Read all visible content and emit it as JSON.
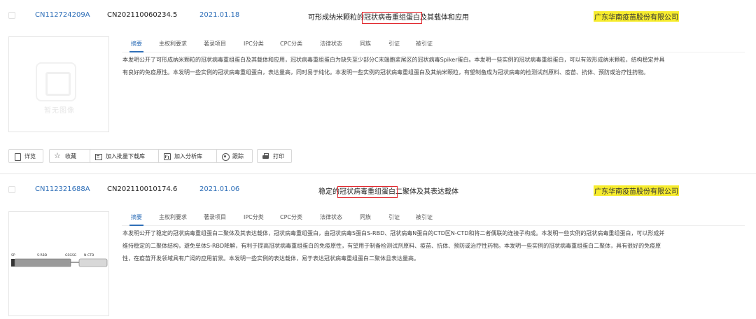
{
  "results": [
    {
      "publication_no": "CN112724209A",
      "application_no": "CN202110060234.5",
      "date": "2021.01.18",
      "title_pre": "可形成纳米颗粒的",
      "title_hl": "冠状病毒重组蛋白",
      "title_post": "及其载体和应用",
      "owner": "广东华南疫苗股份有限公司",
      "thumbnail_placeholder": "暂无图像",
      "tabs": [
        "摘要",
        "主权利要求",
        "著录项目",
        "IPC分类",
        "CPC分类",
        "法律状态",
        "同族",
        "引证",
        "被引证"
      ],
      "active_tab": "摘要",
      "abstract_lines": [
        "本发明公开了可形成纳米颗粒的冠状病毒重组蛋白及其载体和应用，冠状病毒重组蛋白为缺失至少部分C末端胞浆尾区的冠状病毒Spiker蛋白。本发明一些实例的冠状病毒重组蛋白，可以有效形成纳米颗粒，结构稳定并具",
        "有良好的免疫原性。本发明一些实例的冠状病毒重组蛋白，表达量高，同时易于纯化。本发明一些实例的冠状病毒重组蛋白及其纳米颗粒，有望制备成为冠状病毒的检测试剂原料、疫苗、抗体、预防或治疗性药物。"
      ],
      "actions": [
        {
          "label": "详览",
          "icon": "detail-icon"
        },
        {
          "label": "收藏",
          "icon": "star-icon"
        },
        {
          "label": "加入批量下载库",
          "icon": "batch-download-icon"
        },
        {
          "label": "加入分析库",
          "icon": "analysis-icon"
        },
        {
          "label": "跟踪",
          "icon": "track-icon"
        },
        {
          "label": "打印",
          "icon": "print-icon"
        }
      ]
    },
    {
      "publication_no": "CN112321688A",
      "application_no": "CN202110010174.6",
      "date": "2021.01.06",
      "title_pre": "稳定的",
      "title_hl": "冠状病毒重组蛋白",
      "title_post": "二聚体及其表达载体",
      "owner": "广东华南疫苗股份有限公司",
      "diagram_labels": [
        "SP",
        "S-RBD",
        "GSGSG",
        "N-CTD"
      ],
      "tabs": [
        "摘要",
        "主权利要求",
        "著录项目",
        "IPC分类",
        "CPC分类",
        "法律状态",
        "同族",
        "引证",
        "被引证"
      ],
      "active_tab": "摘要",
      "abstract_lines": [
        "本发明公开了稳定的冠状病毒重组蛋白二聚体及其表达载体，冠状病毒重组蛋白，由冠状病毒S蛋白S-RBD、冠状病毒N蛋白的CTD区N-CTD和将二者偶联的连接子构成。本发明一些实例的冠状病毒重组蛋白，可以形成并",
        "维持稳定的二聚体结构，避免单体S-RBD降解，有利于提高冠状病毒重组蛋白的免疫原性，有望用于制备检测试剂原料、疫苗、抗体、预防或治疗性药物。本发明一些实例的冠状病毒重组蛋白二聚体，具有很好的免疫原",
        "性，在疫苗开发领域具有广阔的应用前景。本发明一些实例的表达载体，易于表达冠状病毒重组蛋白二聚体且表达量高。"
      ]
    }
  ],
  "colors": {
    "link_blue": "#2f6fb8",
    "highlight_yellow": "#f7ec2e",
    "highlight_box_red": "#e0262c"
  }
}
